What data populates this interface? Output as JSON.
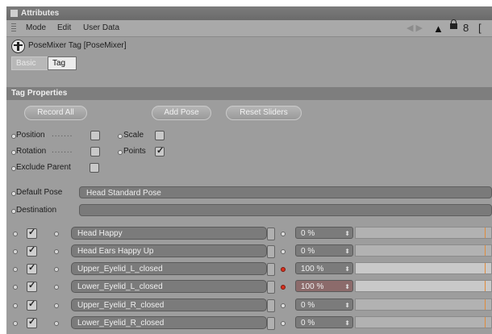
{
  "window": {
    "title": "Attributes"
  },
  "menu": {
    "items": [
      "Mode",
      "Edit",
      "User Data"
    ]
  },
  "object": {
    "title": "PoseMixer Tag [PoseMixer]",
    "icon": "posemixer-icon"
  },
  "tabs": [
    {
      "label": "Basic",
      "active": false
    },
    {
      "label": "Tag",
      "active": true
    }
  ],
  "section": {
    "title": "Tag Properties"
  },
  "buttons": {
    "record_all": "Record All",
    "add_pose": "Add Pose",
    "reset_sliders": "Reset Sliders"
  },
  "options": {
    "position": {
      "label": "Position",
      "checked": false
    },
    "scale": {
      "label": "Scale",
      "checked": false
    },
    "rotation": {
      "label": "Rotation",
      "checked": false
    },
    "points": {
      "label": "Points",
      "checked": true
    },
    "exclude_parent": {
      "label": "Exclude Parent",
      "checked": false
    }
  },
  "default_pose": {
    "label": "Default Pose",
    "value": "Head Standard Pose"
  },
  "destination": {
    "label": "Destination",
    "value": ""
  },
  "poses": [
    {
      "name": "Head Happy",
      "value": "0 %",
      "enabled": true,
      "keyed": false,
      "level": 0
    },
    {
      "name": "Head Ears Happy Up",
      "value": "0 %",
      "enabled": true,
      "keyed": false,
      "level": 0
    },
    {
      "name": "Upper_Eyelid_L_closed",
      "value": "100 %",
      "enabled": true,
      "keyed": true,
      "level": 1
    },
    {
      "name": "Lower_Eyelid_L_closed",
      "value": "100 %",
      "enabled": true,
      "keyed": true,
      "level": 1
    },
    {
      "name": "Upper_Eyelid_R_closed",
      "value": "0 %",
      "enabled": true,
      "keyed": false,
      "level": 0
    },
    {
      "name": "Lower_Eyelid_R_closed",
      "value": "0 %",
      "enabled": true,
      "keyed": false,
      "level": 0
    }
  ],
  "colors": {
    "panel": "#9d9d9d",
    "titlebar": "#6f6f6f",
    "key_red": "#d8301e",
    "slider_marker": "#e08a3a"
  }
}
